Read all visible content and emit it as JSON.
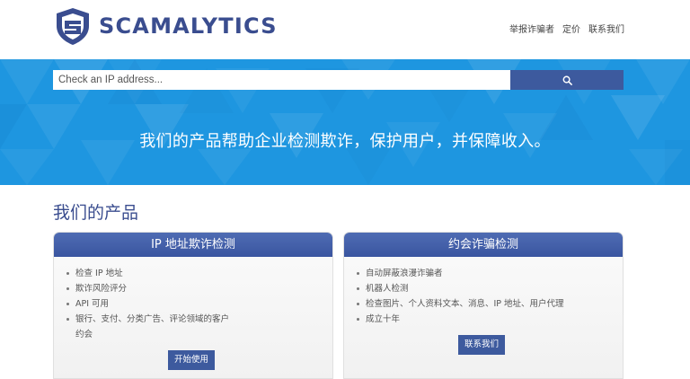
{
  "brand": {
    "name": "SCAMALYTICS"
  },
  "nav": {
    "items": [
      "举报诈骗者",
      "定价",
      "联系我们"
    ]
  },
  "search": {
    "placeholder": "Check an IP address...",
    "icon": "search-icon"
  },
  "hero": {
    "tagline": "我们的产品帮助企业检测欺诈，保护用户，并保障收入。"
  },
  "products": {
    "title": "我们的产品",
    "cards": [
      {
        "heading": "IP 地址欺诈检测",
        "items": [
          "检查 IP 地址",
          "欺诈风险评分",
          "API 可用",
          "银行、支付、分类广告、评论领域的客户",
          "约会"
        ],
        "button": "开始使用"
      },
      {
        "heading": "约会诈骗检测",
        "items": [
          "自动屏蔽浪漫诈骗者",
          "机器人检测",
          "检查图片、个人资料文本、消息、IP 地址、用户代理",
          "成立十年"
        ],
        "button": "联系我们"
      }
    ]
  },
  "colors": {
    "brand": "#3a4d8f",
    "hero": "#1e96e0",
    "button": "#3d5a9e"
  }
}
